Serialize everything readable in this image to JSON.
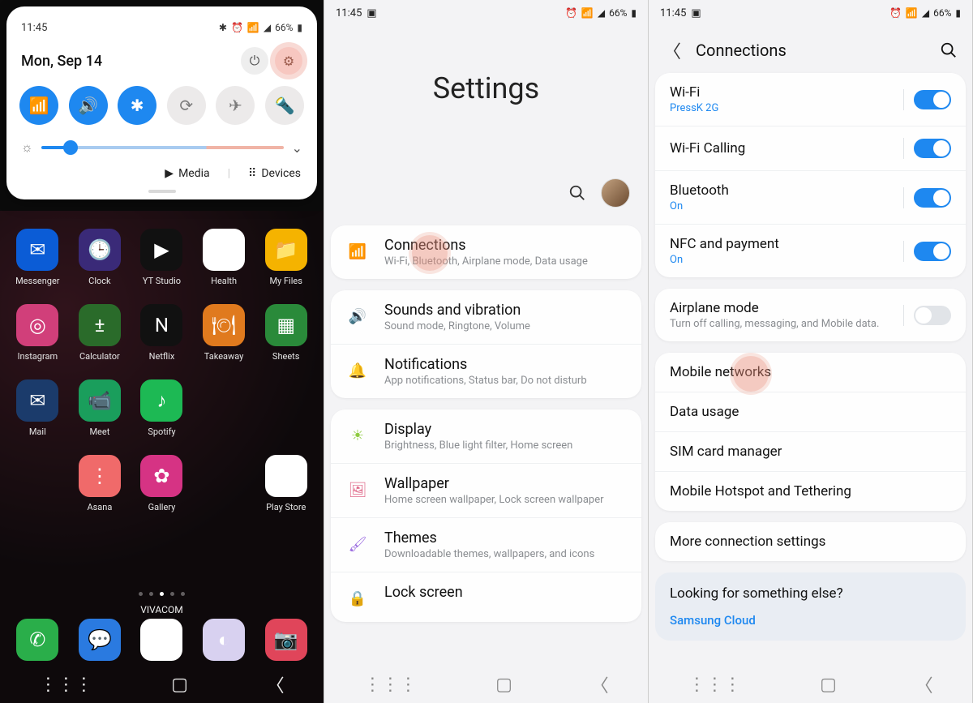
{
  "status": {
    "time": "11:45",
    "battery_pct": "66%",
    "bt": true,
    "alarm": true,
    "wifi": true,
    "signal": true
  },
  "phone1": {
    "date": "Mon, Sep 14",
    "toggles": [
      {
        "name": "wifi",
        "on": true
      },
      {
        "name": "sound",
        "on": true
      },
      {
        "name": "bluetooth",
        "on": true
      },
      {
        "name": "rotation",
        "on": false
      },
      {
        "name": "airplane",
        "on": false
      },
      {
        "name": "flashlight",
        "on": false
      }
    ],
    "brightness_pct": 12,
    "media_label": "Media",
    "devices_label": "Devices",
    "apps": [
      {
        "label": "Messenger",
        "color": "#0b5cd6",
        "glyph": "✉"
      },
      {
        "label": "Clock",
        "color": "#3a2a78",
        "glyph": "🕒"
      },
      {
        "label": "YT Studio",
        "color": "#111",
        "glyph": "▶"
      },
      {
        "label": "Health",
        "color": "#fff",
        "glyph": "❤"
      },
      {
        "label": "My Files",
        "color": "#f5b300",
        "glyph": "📁"
      },
      {
        "label": "Instagram",
        "color": "#d13f7a",
        "glyph": "◎"
      },
      {
        "label": "Calculator",
        "color": "#2a6b2a",
        "glyph": "±"
      },
      {
        "label": "Netflix",
        "color": "#111",
        "glyph": "N"
      },
      {
        "label": "Takeaway",
        "color": "#e07a1e",
        "glyph": "🍽"
      },
      {
        "label": "Sheets",
        "color": "#2a8a3a",
        "glyph": "▦"
      },
      {
        "label": "Mail",
        "color": "#1b3b6b",
        "glyph": "✉"
      },
      {
        "label": "Meet",
        "color": "#1a9e5c",
        "glyph": "📹"
      },
      {
        "label": "Spotify",
        "color": "#1db954",
        "glyph": "♪"
      },
      {
        "label": "",
        "color": "",
        "glyph": ""
      },
      {
        "label": "",
        "color": "",
        "glyph": ""
      },
      {
        "label": "",
        "color": "",
        "glyph": ""
      },
      {
        "label": "Asana",
        "color": "#f06a6a",
        "glyph": "⋮"
      },
      {
        "label": "Gallery",
        "color": "#d63384",
        "glyph": "✿"
      },
      {
        "label": "",
        "color": "",
        "glyph": ""
      },
      {
        "label": "Play Store",
        "color": "#fff",
        "glyph": "▶"
      }
    ],
    "dock": [
      {
        "name": "phone",
        "color": "#2aae4a",
        "glyph": "✆"
      },
      {
        "name": "messages",
        "color": "#2a7ae0",
        "glyph": "💬"
      },
      {
        "name": "chrome",
        "color": "#fff",
        "glyph": "◉"
      },
      {
        "name": "internet",
        "color": "#d8d1f0",
        "glyph": "◐"
      },
      {
        "name": "camera",
        "color": "#e0455a",
        "glyph": "📷"
      }
    ],
    "carrier": "VIVACOM"
  },
  "phone2": {
    "heading": "Settings",
    "groups": [
      [
        {
          "icon": "wifi",
          "color": "#3b8bea",
          "title": "Connections",
          "sub": "Wi-Fi, Bluetooth, Airplane mode, Data usage",
          "highlight": true
        }
      ],
      [
        {
          "icon": "sound",
          "color": "#3b8bea",
          "title": "Sounds and vibration",
          "sub": "Sound mode, Ringtone, Volume"
        },
        {
          "icon": "bell",
          "color": "#e96a5a",
          "title": "Notifications",
          "sub": "App notifications, Status bar, Do not disturb"
        }
      ],
      [
        {
          "icon": "sun",
          "color": "#8ecb3f",
          "title": "Display",
          "sub": "Brightness, Blue light filter, Home screen"
        },
        {
          "icon": "image",
          "color": "#e06a8a",
          "title": "Wallpaper",
          "sub": "Home screen wallpaper, Lock screen wallpaper"
        },
        {
          "icon": "brush",
          "color": "#9a6ae0",
          "title": "Themes",
          "sub": "Downloadable themes, wallpapers, and icons"
        },
        {
          "icon": "lock",
          "color": "#2aa0a0",
          "title": "Lock screen",
          "sub": ""
        }
      ]
    ]
  },
  "phone3": {
    "title": "Connections",
    "groups": [
      [
        {
          "title": "Wi-Fi",
          "sub": "PressK 2G",
          "sub_blue": true,
          "toggle": "on"
        },
        {
          "title": "Wi-Fi Calling",
          "toggle": "on"
        },
        {
          "title": "Bluetooth",
          "sub": "On",
          "sub_blue": true,
          "toggle": "on"
        },
        {
          "title": "NFC and payment",
          "sub": "On",
          "sub_blue": true,
          "toggle": "on"
        }
      ],
      [
        {
          "title": "Airplane mode",
          "sub": "Turn off calling, messaging, and Mobile data.",
          "sub_blue": false,
          "toggle": "off"
        }
      ],
      [
        {
          "title": "Mobile networks",
          "highlight": true
        },
        {
          "title": "Data usage"
        },
        {
          "title": "SIM card manager"
        },
        {
          "title": "Mobile Hotspot and Tethering"
        }
      ],
      [
        {
          "title": "More connection settings"
        }
      ]
    ],
    "footer": {
      "label": "Looking for something else?",
      "link": "Samsung Cloud"
    }
  }
}
